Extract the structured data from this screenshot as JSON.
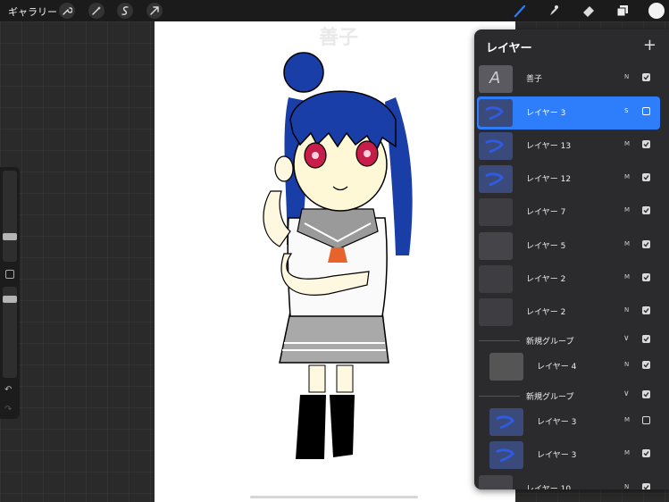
{
  "topbar": {
    "gallery_label": "ギャラリー",
    "tools_left": [
      "wrench-icon",
      "magic-wand-icon",
      "selection-icon",
      "transform-arrow-icon"
    ],
    "tools_right": [
      "brush-icon",
      "smudge-icon",
      "eraser-icon",
      "layers-icon",
      "color-picker-icon"
    ],
    "accent": "#2e7dfb"
  },
  "canvas": {
    "text_layer_value": "善子"
  },
  "layers_panel": {
    "title": "レイヤー",
    "add_symbol": "+",
    "layers": [
      {
        "name": "善子",
        "mode": "N",
        "visible": true,
        "selected": false,
        "indent": false,
        "thumb": "text"
      },
      {
        "name": "レイヤー 3",
        "mode": "S",
        "visible": false,
        "selected": true,
        "indent": false,
        "thumb": "blue"
      },
      {
        "name": "レイヤー 13",
        "mode": "M",
        "visible": true,
        "selected": false,
        "indent": false,
        "thumb": "blue"
      },
      {
        "name": "レイヤー 12",
        "mode": "M",
        "visible": true,
        "selected": false,
        "indent": false,
        "thumb": "blue"
      },
      {
        "name": "レイヤー 7",
        "mode": "M",
        "visible": true,
        "selected": false,
        "indent": false,
        "thumb": "grey"
      },
      {
        "name": "レイヤー 5",
        "mode": "M",
        "visible": true,
        "selected": false,
        "indent": false,
        "thumb": "white"
      },
      {
        "name": "レイヤー 2",
        "mode": "M",
        "visible": true,
        "selected": false,
        "indent": false,
        "thumb": "grey"
      },
      {
        "name": "レイヤー 2",
        "mode": "N",
        "visible": true,
        "selected": false,
        "indent": false,
        "thumb": "grey"
      },
      {
        "group": true,
        "name": "新規グループ",
        "expanded": true
      },
      {
        "name": "レイヤー 4",
        "mode": "N",
        "visible": true,
        "selected": false,
        "indent": true,
        "thumb": "light"
      },
      {
        "group": true,
        "name": "新規グループ",
        "expanded": true
      },
      {
        "name": "レイヤー 3",
        "mode": "M",
        "visible": false,
        "selected": false,
        "indent": true,
        "thumb": "blue"
      },
      {
        "name": "レイヤー 3",
        "mode": "M",
        "visible": true,
        "selected": false,
        "indent": true,
        "thumb": "blue"
      },
      {
        "name": "レイヤー 10",
        "mode": "N",
        "visible": true,
        "selected": false,
        "indent": false,
        "thumb": "white"
      }
    ]
  }
}
